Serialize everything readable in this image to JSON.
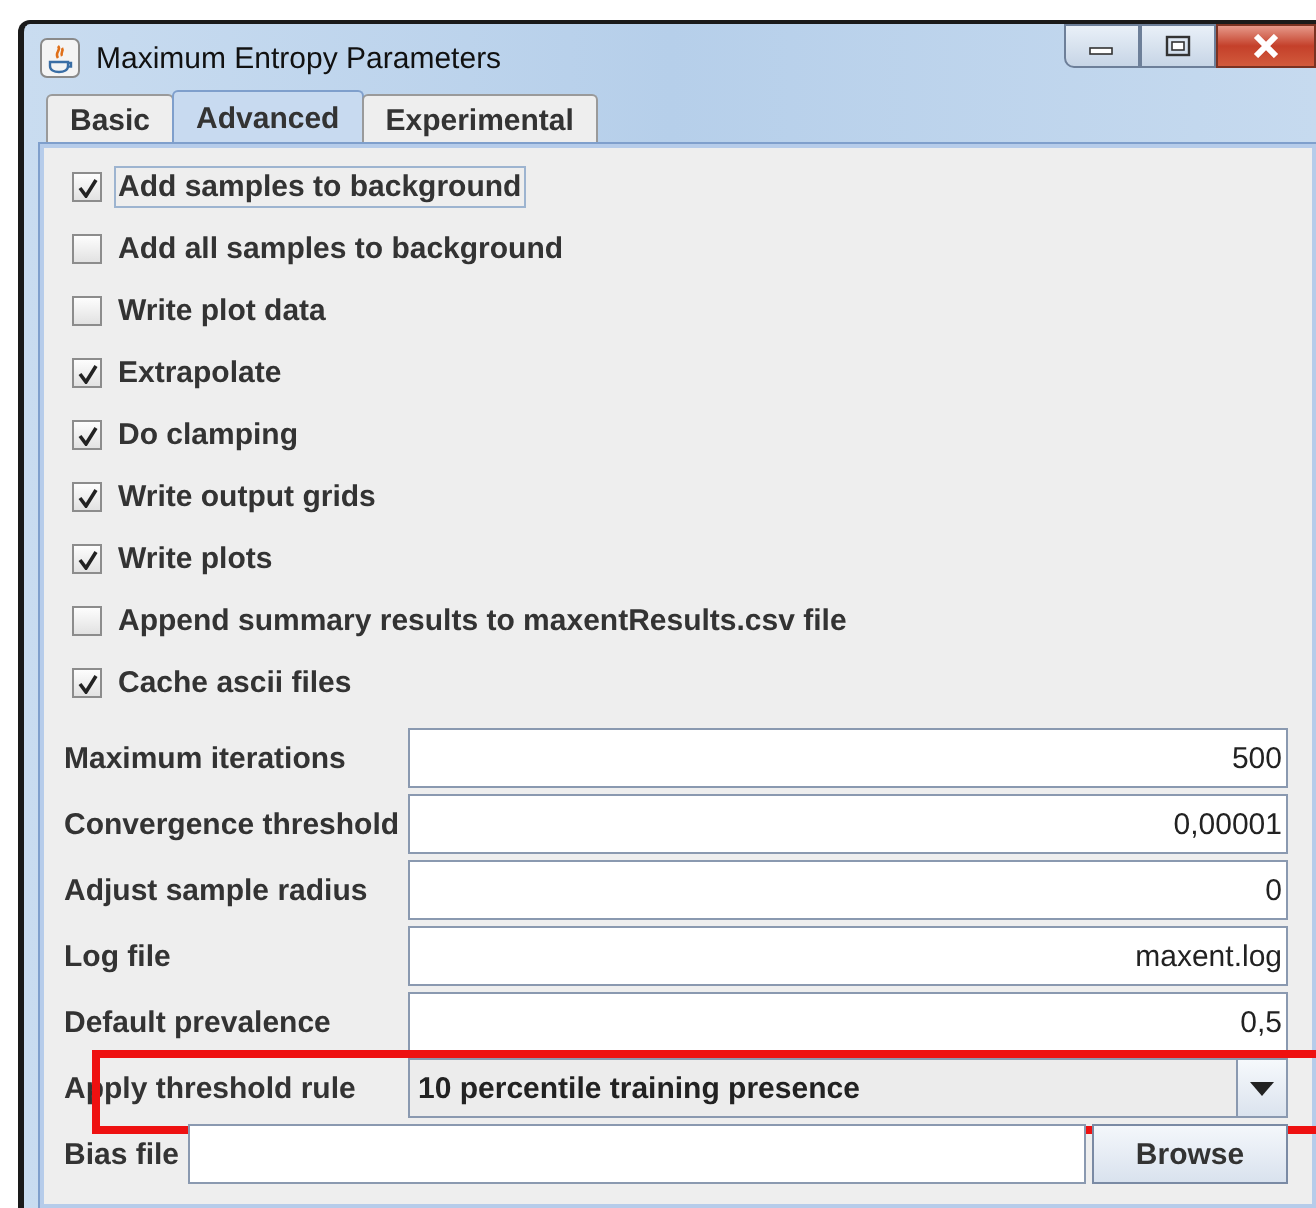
{
  "window": {
    "title": "Maximum Entropy Parameters"
  },
  "tabs": [
    {
      "label": "Basic",
      "selected": false
    },
    {
      "label": "Advanced",
      "selected": true
    },
    {
      "label": "Experimental",
      "selected": false
    }
  ],
  "options": [
    {
      "label": "Add samples to background",
      "checked": true,
      "focused": true
    },
    {
      "label": "Add all samples to background",
      "checked": false,
      "focused": false
    },
    {
      "label": "Write plot data",
      "checked": false,
      "focused": false
    },
    {
      "label": "Extrapolate",
      "checked": true,
      "focused": false
    },
    {
      "label": "Do clamping",
      "checked": true,
      "focused": false
    },
    {
      "label": "Write output grids",
      "checked": true,
      "focused": false
    },
    {
      "label": "Write plots",
      "checked": true,
      "focused": false
    },
    {
      "label": "Append summary results to maxentResults.csv file",
      "checked": false,
      "focused": false
    },
    {
      "label": "Cache ascii files",
      "checked": true,
      "focused": false
    }
  ],
  "fields": [
    {
      "kind": "text",
      "label": "Maximum iterations",
      "value": "500",
      "highlighted": false
    },
    {
      "kind": "text",
      "label": "Convergence threshold",
      "value": "0,00001",
      "highlighted": false
    },
    {
      "kind": "text",
      "label": "Adjust sample radius",
      "value": "0",
      "highlighted": false
    },
    {
      "kind": "text",
      "label": "Log file",
      "value": "maxent.log",
      "highlighted": false
    },
    {
      "kind": "text",
      "label": "Default prevalence",
      "value": "0,5",
      "highlighted": false
    },
    {
      "kind": "dropdown",
      "label": "Apply threshold rule",
      "value": "10 percentile training presence",
      "highlighted": true
    },
    {
      "kind": "file",
      "label": "Bias file",
      "button": "Browse",
      "highlighted": false
    }
  ]
}
